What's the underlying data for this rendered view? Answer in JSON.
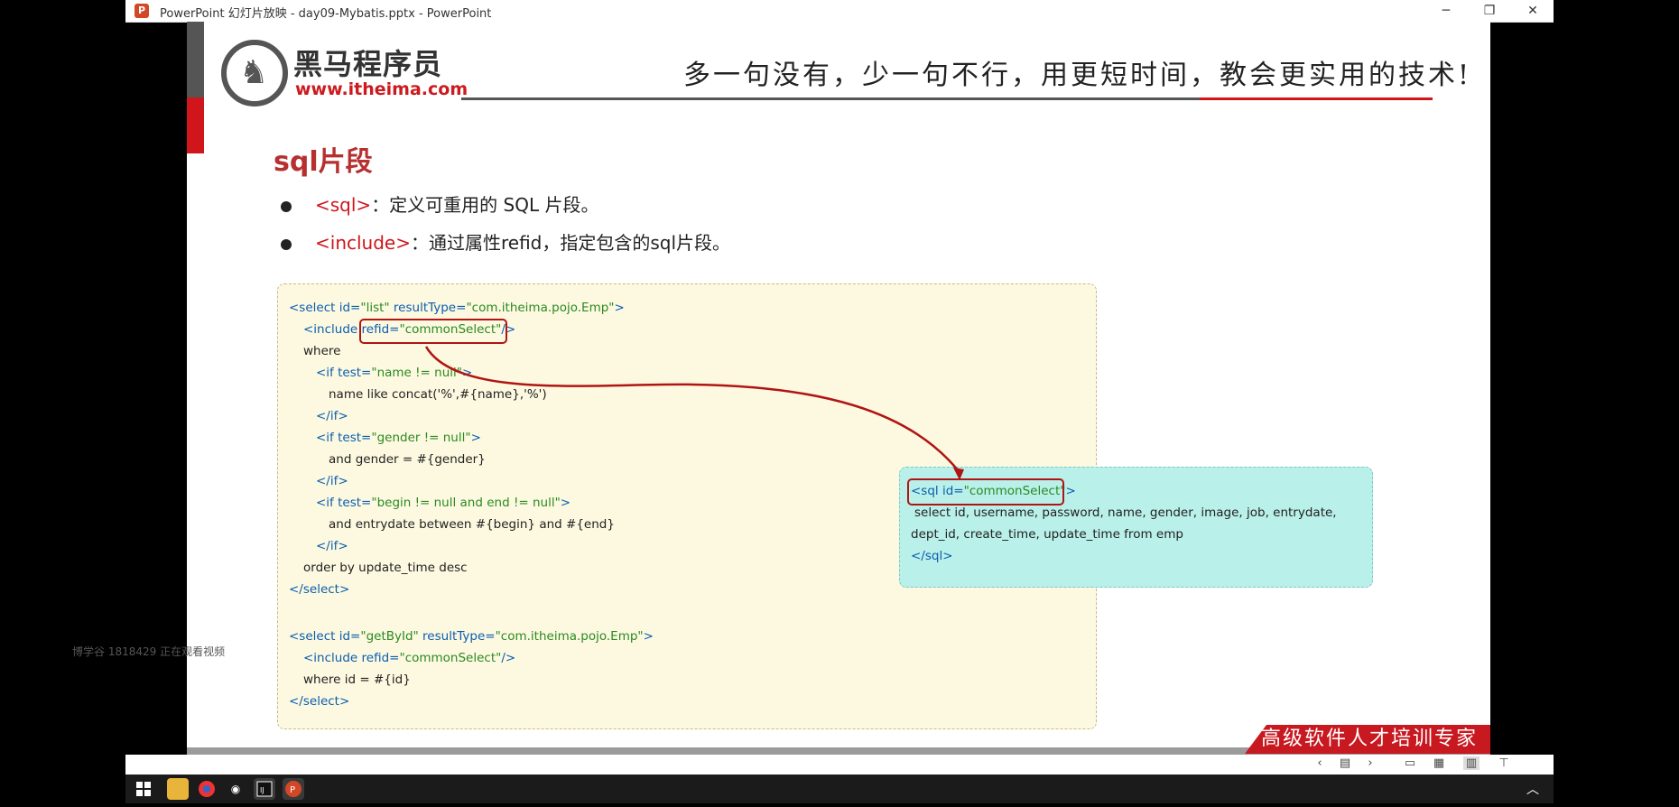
{
  "window": {
    "title": "PowerPoint 幻灯片放映  -  day09-Mybatis.pptx  -  PowerPoint",
    "app_icon": "P",
    "controls": {
      "minimize": "─",
      "maximize": "❐",
      "close": "✕"
    }
  },
  "slide": {
    "brand_name": "黑马程序员",
    "brand_url": "www.itheima.com",
    "slogan": "多一句没有，少一句不行，用更短时间，教会更实用的技术!",
    "title": "sql片段",
    "bullets": [
      {
        "keyword": "<sql>",
        "text": "：定义可重用的 SQL 片段。"
      },
      {
        "keyword": "<include>",
        "text": "：通过属性refid，指定包含的sql片段。"
      }
    ],
    "code": {
      "l1": {
        "t1": "<select",
        "a1": " id=",
        "v1": "\"list\"",
        "a2": " resultType=",
        "v2": "\"com.itheima.pojo.Emp\"",
        "t2": ">"
      },
      "l2": {
        "t1": "<include",
        "a1": " refid=",
        "v1": "\"commonSelect\"",
        "t2": "/>"
      },
      "l3": "where",
      "l4": {
        "t1": "<if",
        "a1": " test=",
        "v1": "\"name != null\"",
        "t2": ">"
      },
      "l5": "name like concat('%',#{name},'%')",
      "l6": "</if>",
      "l7": {
        "t1": "<if",
        "a1": " test=",
        "v1": "\"gender != null\"",
        "t2": ">"
      },
      "l8": "and gender = #{gender}",
      "l9": "</if>",
      "l10": {
        "t1": "<if",
        "a1": " test=",
        "v1": "\"begin != null and end != null\"",
        "t2": ">"
      },
      "l11": "and entrydate between #{begin} and #{end}",
      "l12": "</if>",
      "l13": "order by update_time desc",
      "l14": "</select>",
      "l15": {
        "t1": "<select",
        "a1": " id=",
        "v1": "\"getById\"",
        "a2": " resultType=",
        "v2": "\"com.itheima.pojo.Emp\"",
        "t2": ">"
      },
      "l16": {
        "t1": "<include",
        "a1": " refid=",
        "v1": "\"commonSelect\"",
        "t2": "/>"
      },
      "l17": "where  id = #{id}",
      "l18": "</select>"
    },
    "sql": {
      "l1": {
        "t1": "<sql",
        "a1": " id=",
        "v1": "\"commonSelect\"",
        "t2": ">"
      },
      "l2": "select id, username, password, name, gender, image, job, entrydate,",
      "l3": "dept_id, create_time, update_time from emp",
      "l4": "</sql>"
    },
    "footer_banner": "高级软件人才培训专家"
  },
  "watermark": "博学谷 1818429 正在观看视频",
  "statusbar": {
    "icons": [
      "prev-icon",
      "slide-list-icon",
      "next-icon",
      "normal-view-icon",
      "slide-sorter-icon",
      "reading-view-icon",
      "slideshow-icon"
    ]
  },
  "taskbar": {
    "items": [
      "start-icon",
      "file-explorer-icon",
      "chrome-icon",
      "app-icon",
      "intellij-icon",
      "powerpoint-icon"
    ]
  },
  "colors": {
    "brand_red": "#d0151b",
    "title_red": "#b73030",
    "code_bg": "#fdf9e0",
    "sql_bg": "#b9f0e9",
    "tag_blue": "#0a5db0",
    "value_green": "#2a8a22"
  }
}
